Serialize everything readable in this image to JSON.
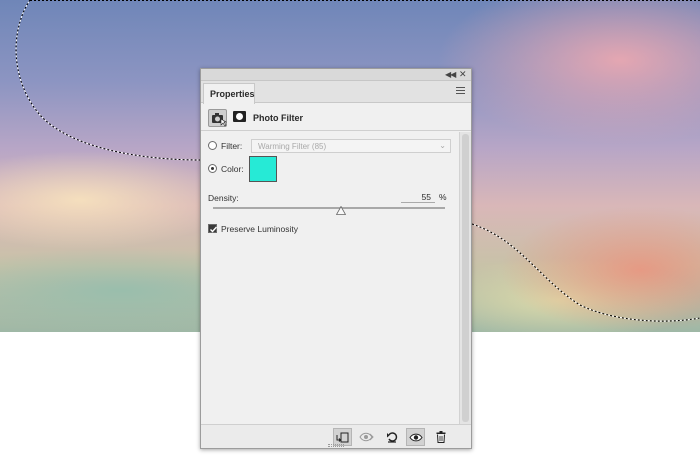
{
  "panel": {
    "tab_label": "Properties",
    "adjustment_title": "Photo Filter",
    "filter_label": "Filter:",
    "filter_value": "Warming Filter (85)",
    "color_label": "Color:",
    "color_value": "#26ead6",
    "density_label": "Density:",
    "density_value": "55",
    "density_unit": "%",
    "density_fraction": 0.55,
    "preserve_label": "Preserve Luminosity",
    "preserve_checked": true,
    "selected_mode": "color"
  },
  "icons": {
    "titlebar": [
      "collapse-icon",
      "close-icon"
    ],
    "header": [
      "adjustment-layer-icon",
      "mask-icon"
    ],
    "panel_menu": "menu-icon",
    "footer": [
      "clip-to-layer-icon",
      "view-previous-state-icon",
      "reset-icon",
      "visibility-icon",
      "delete-icon"
    ]
  },
  "colors": {
    "accent_swatch": "#26ead6",
    "panel_bg": "#f0f0f0"
  }
}
